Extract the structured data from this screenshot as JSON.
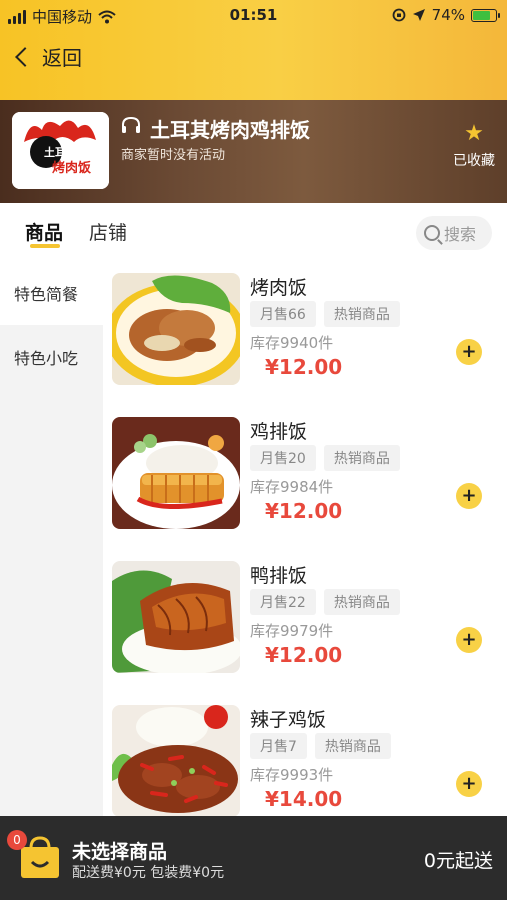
{
  "status": {
    "carrier": "中国移动",
    "time": "01:51",
    "battery": "74%"
  },
  "nav": {
    "back_label": "返回"
  },
  "shop": {
    "name": "土耳其烤肉鸡排饭",
    "activity": "商家暂时没有活动",
    "favorite_label": "已收藏",
    "logo_text_line1": "土耳其",
    "logo_text_line2": "烤肉饭"
  },
  "tabs": [
    {
      "label": "商品",
      "active": true
    },
    {
      "label": "店铺",
      "active": false
    }
  ],
  "search": {
    "placeholder": "搜索"
  },
  "categories": [
    {
      "label": "特色简餐",
      "active": true
    },
    {
      "label": "特色小吃",
      "active": false
    }
  ],
  "products": [
    {
      "name": "烤肉饭",
      "sales": "月售66",
      "tag": "热销商品",
      "stock": "库存9940件",
      "price": "¥12.00"
    },
    {
      "name": "鸡排饭",
      "sales": "月售20",
      "tag": "热销商品",
      "stock": "库存9984件",
      "price": "¥12.00"
    },
    {
      "name": "鸭排饭",
      "sales": "月售22",
      "tag": "热销商品",
      "stock": "库存9979件",
      "price": "¥12.00"
    },
    {
      "name": "辣子鸡饭",
      "sales": "月售7",
      "tag": "热销商品",
      "stock": "库存9993件",
      "price": "¥14.00"
    }
  ],
  "cart": {
    "count": "0",
    "title": "未选择商品",
    "fees": "配送费¥0元 包装费¥0元",
    "min_order": "0元起送"
  }
}
